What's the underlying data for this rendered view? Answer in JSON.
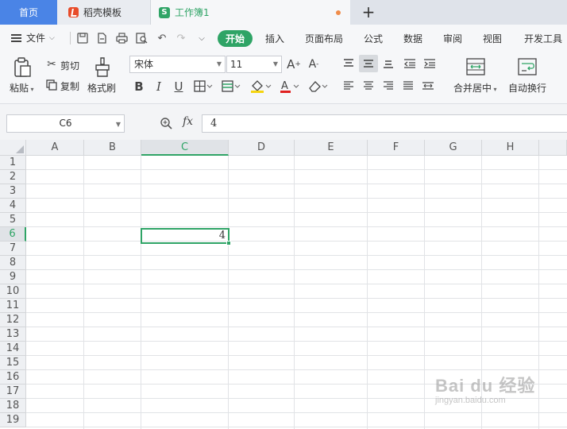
{
  "tabs": {
    "home": "首页",
    "templates": "稻壳模板",
    "workbook": "工作簿1"
  },
  "menu": {
    "file": "文件",
    "items": [
      "开始",
      "插入",
      "页面布局",
      "公式",
      "数据",
      "审阅",
      "视图",
      "开发工具"
    ],
    "active": "开始"
  },
  "ribbon": {
    "paste": "粘贴",
    "cut": "剪切",
    "copy": "复制",
    "format_painter": "格式刷",
    "font_name": "宋体",
    "font_size": "11",
    "bold": "B",
    "italic": "I",
    "underline": "U",
    "merge_center": "合并居中",
    "wrap_text": "自动换行"
  },
  "formula_bar": {
    "name_box": "C6",
    "fx": "fx",
    "value": "4"
  },
  "sheet": {
    "columns": [
      "A",
      "B",
      "C",
      "D",
      "E",
      "F",
      "G",
      "H"
    ],
    "rows": [
      "1",
      "2",
      "3",
      "4",
      "5",
      "6",
      "7",
      "8",
      "9",
      "10",
      "11",
      "12",
      "13",
      "14",
      "15",
      "16",
      "17",
      "18",
      "19"
    ],
    "active_column": "C",
    "active_row": "6",
    "active_cell_value": "4"
  },
  "watermark": {
    "main": "Bai du 经验",
    "sub": "jingyan.baidu.com"
  },
  "colors": {
    "accent": "#2fa466",
    "home_tab": "#4a84e6"
  }
}
